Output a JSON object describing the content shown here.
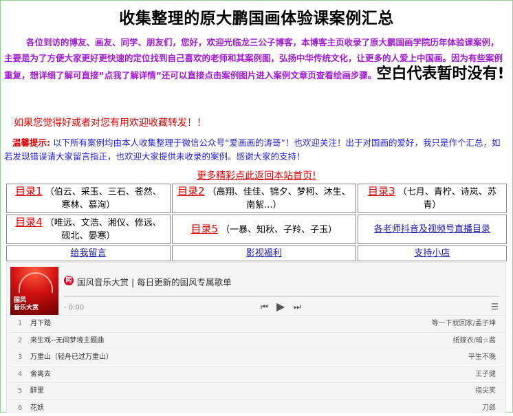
{
  "title": "收集整理的原大鹏国画体验课案例汇总",
  "intro": {
    "text": "各位到访的博友、画友、同学、朋友们，您好，欢迎光临龙三公子博客，本博客主页收录了原大鹏国画学院历年体验课案例，主要是为了方便大家更好更快速的定位找到自己喜欢的老师和其案例图，弘扬中华传统文化，让更多的人爱上中国画。因为有些案例重复，想详细了解可直接“点我了解详情”还可以直接点击案例图片进入案例文章页查看绘画步骤。",
    "emphasis": "空白代表暂时没有!"
  },
  "favorite": "如果您觉得好或者对您有用欢迎收藏转发！！",
  "notice": {
    "label": "温馨提示:",
    "text": "以下所有案例均由本人收集整理于微信公众号“爱画画的涛哥”！也欢迎关注！出于对国画的爱好，我只是作个汇总，如若发现错误请大家留言指正，也欢迎大家提供未收录的案例。感谢大家的支持！"
  },
  "more_link": "更多精彩点此返回本站首页!",
  "directory": {
    "c1": {
      "link": "目录1",
      "names": "（伯云、采玉、三石、苍然、寒林、慕洵）"
    },
    "c2": {
      "link": "目录2",
      "names": "（高翔、佳佳、锦夕、梦柯、沐生、南絮...）"
    },
    "c3": {
      "link": "目录3",
      "names": "（七月、青柠、诗岚、苏青）"
    },
    "c4": {
      "link": "目录4",
      "names": "（唯远、文浩、湘仪、修远、砚北、晏寒）"
    },
    "c5": {
      "link": "目录5",
      "names": "（一暴、知秋、子羚、子玉）"
    },
    "c6": {
      "link": "各老师抖音及视频号直播目录"
    },
    "c7": {
      "link": "给我留言"
    },
    "c8": {
      "link": "影视福利"
    },
    "c9": {
      "link": "支持小店"
    }
  },
  "player": {
    "cover_text": "国风\n音乐大赏",
    "logo": "网",
    "title": "国风音乐大赏 | 每日更新的国风专属歌单",
    "time": "- 0:00",
    "tracks": [
      {
        "num": "1",
        "song": "月下踏",
        "artist": "等一下就回家/孟子坤"
      },
      {
        "num": "2",
        "song": "来生戏--无间梦境主题曲",
        "artist": "纸嫁衣/暗☆酱"
      },
      {
        "num": "3",
        "song": "万重山（轻舟已过万重山）",
        "artist": "平生不晚"
      },
      {
        "num": "4",
        "song": "舍离去",
        "artist": "王子健"
      },
      {
        "num": "5",
        "song": "醉里",
        "artist": "指尖笑"
      },
      {
        "num": "6",
        "song": "花妖",
        "artist": "刀郎"
      }
    ]
  }
}
